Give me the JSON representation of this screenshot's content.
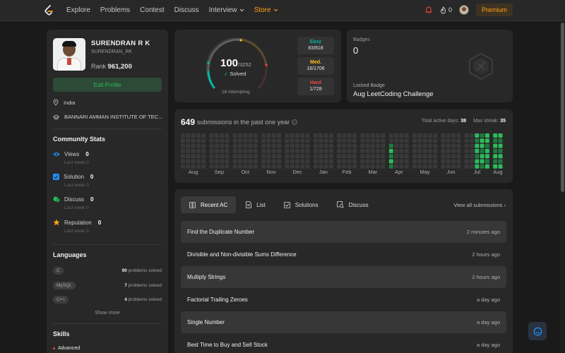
{
  "nav": {
    "items": [
      "Explore",
      "Problems",
      "Contest",
      "Discuss",
      "Interview",
      "Store"
    ],
    "streak_count": "0",
    "premium": "Premium"
  },
  "profile": {
    "name": "SURENDRAN R K",
    "username": "SURENDRAN_RK",
    "rank_label": "Rank",
    "rank_value": "961,200",
    "edit_label": "Edit Profile",
    "location": "India",
    "institution": "BANNARI AMMAN INSTITUTE OF TEC..."
  },
  "community": {
    "title": "Community Stats",
    "last_week_label": "Last week",
    "stats": [
      {
        "label": "Views",
        "value": "0",
        "last_week": "0",
        "color": "#1f8fff"
      },
      {
        "label": "Solution",
        "value": "0",
        "last_week": "0",
        "color": "#1f8fff"
      },
      {
        "label": "Discuss",
        "value": "0",
        "last_week": "0",
        "color": "#2cbb5d"
      },
      {
        "label": "Reputation",
        "value": "0",
        "last_week": "0",
        "color": "#ffa116"
      }
    ]
  },
  "languages": {
    "title": "Languages",
    "suffix": "problems solved",
    "items": [
      {
        "name": "C",
        "count": "90"
      },
      {
        "name": "MySQL",
        "count": "7"
      },
      {
        "name": "C++",
        "count": "4"
      }
    ],
    "show_more": "Show more"
  },
  "skills": {
    "title": "Skills",
    "first": "Advanced"
  },
  "solved": {
    "count": "100",
    "total": "/3252",
    "solved_label": "Solved",
    "attempting": "18 Attempting",
    "difficulties": [
      {
        "label": "Easy",
        "value": "83/818",
        "color": "#00b8a3"
      },
      {
        "label": "Med.",
        "value": "16/1706",
        "color": "#ffc01e"
      },
      {
        "label": "Hard",
        "value": "1/728",
        "color": "#ef4743"
      }
    ]
  },
  "badges": {
    "title": "Badges",
    "count": "0",
    "locked_label": "Locked Badge",
    "locked_name": "Aug LeetCoding Challenge"
  },
  "heatmap": {
    "count": "649",
    "label": "submissions in the past one year",
    "active_days_label": "Total active days:",
    "active_days": "38",
    "max_streak_label": "Max streak:",
    "max_streak": "35",
    "months": [
      "Aug",
      "Sep",
      "Oct",
      "Nov",
      "Dec",
      "Jan",
      "Feb",
      "Mar",
      "Apr",
      "May",
      "Jun",
      "Jul",
      "Aug"
    ]
  },
  "submissions": {
    "tabs": [
      "Recent AC",
      "List",
      "Solutions",
      "Discuss"
    ],
    "view_all": "View all submissions",
    "rows": [
      {
        "title": "Find the Duplicate Number",
        "time": "2 minutes ago"
      },
      {
        "title": "Divisible and Non-divisible Sums Difference",
        "time": "2 hours ago"
      },
      {
        "title": "Multiply Strings",
        "time": "2 hours ago"
      },
      {
        "title": "Factorial Trailing Zeroes",
        "time": "a day ago"
      },
      {
        "title": "Single Number",
        "time": "a day ago"
      },
      {
        "title": "Best Time to Buy and Sell Stock",
        "time": "a day ago"
      }
    ]
  },
  "colors": {
    "accent": "#ffa116",
    "green": "#2cbb5d",
    "card": "#282828",
    "bg": "#1a1a1a"
  }
}
